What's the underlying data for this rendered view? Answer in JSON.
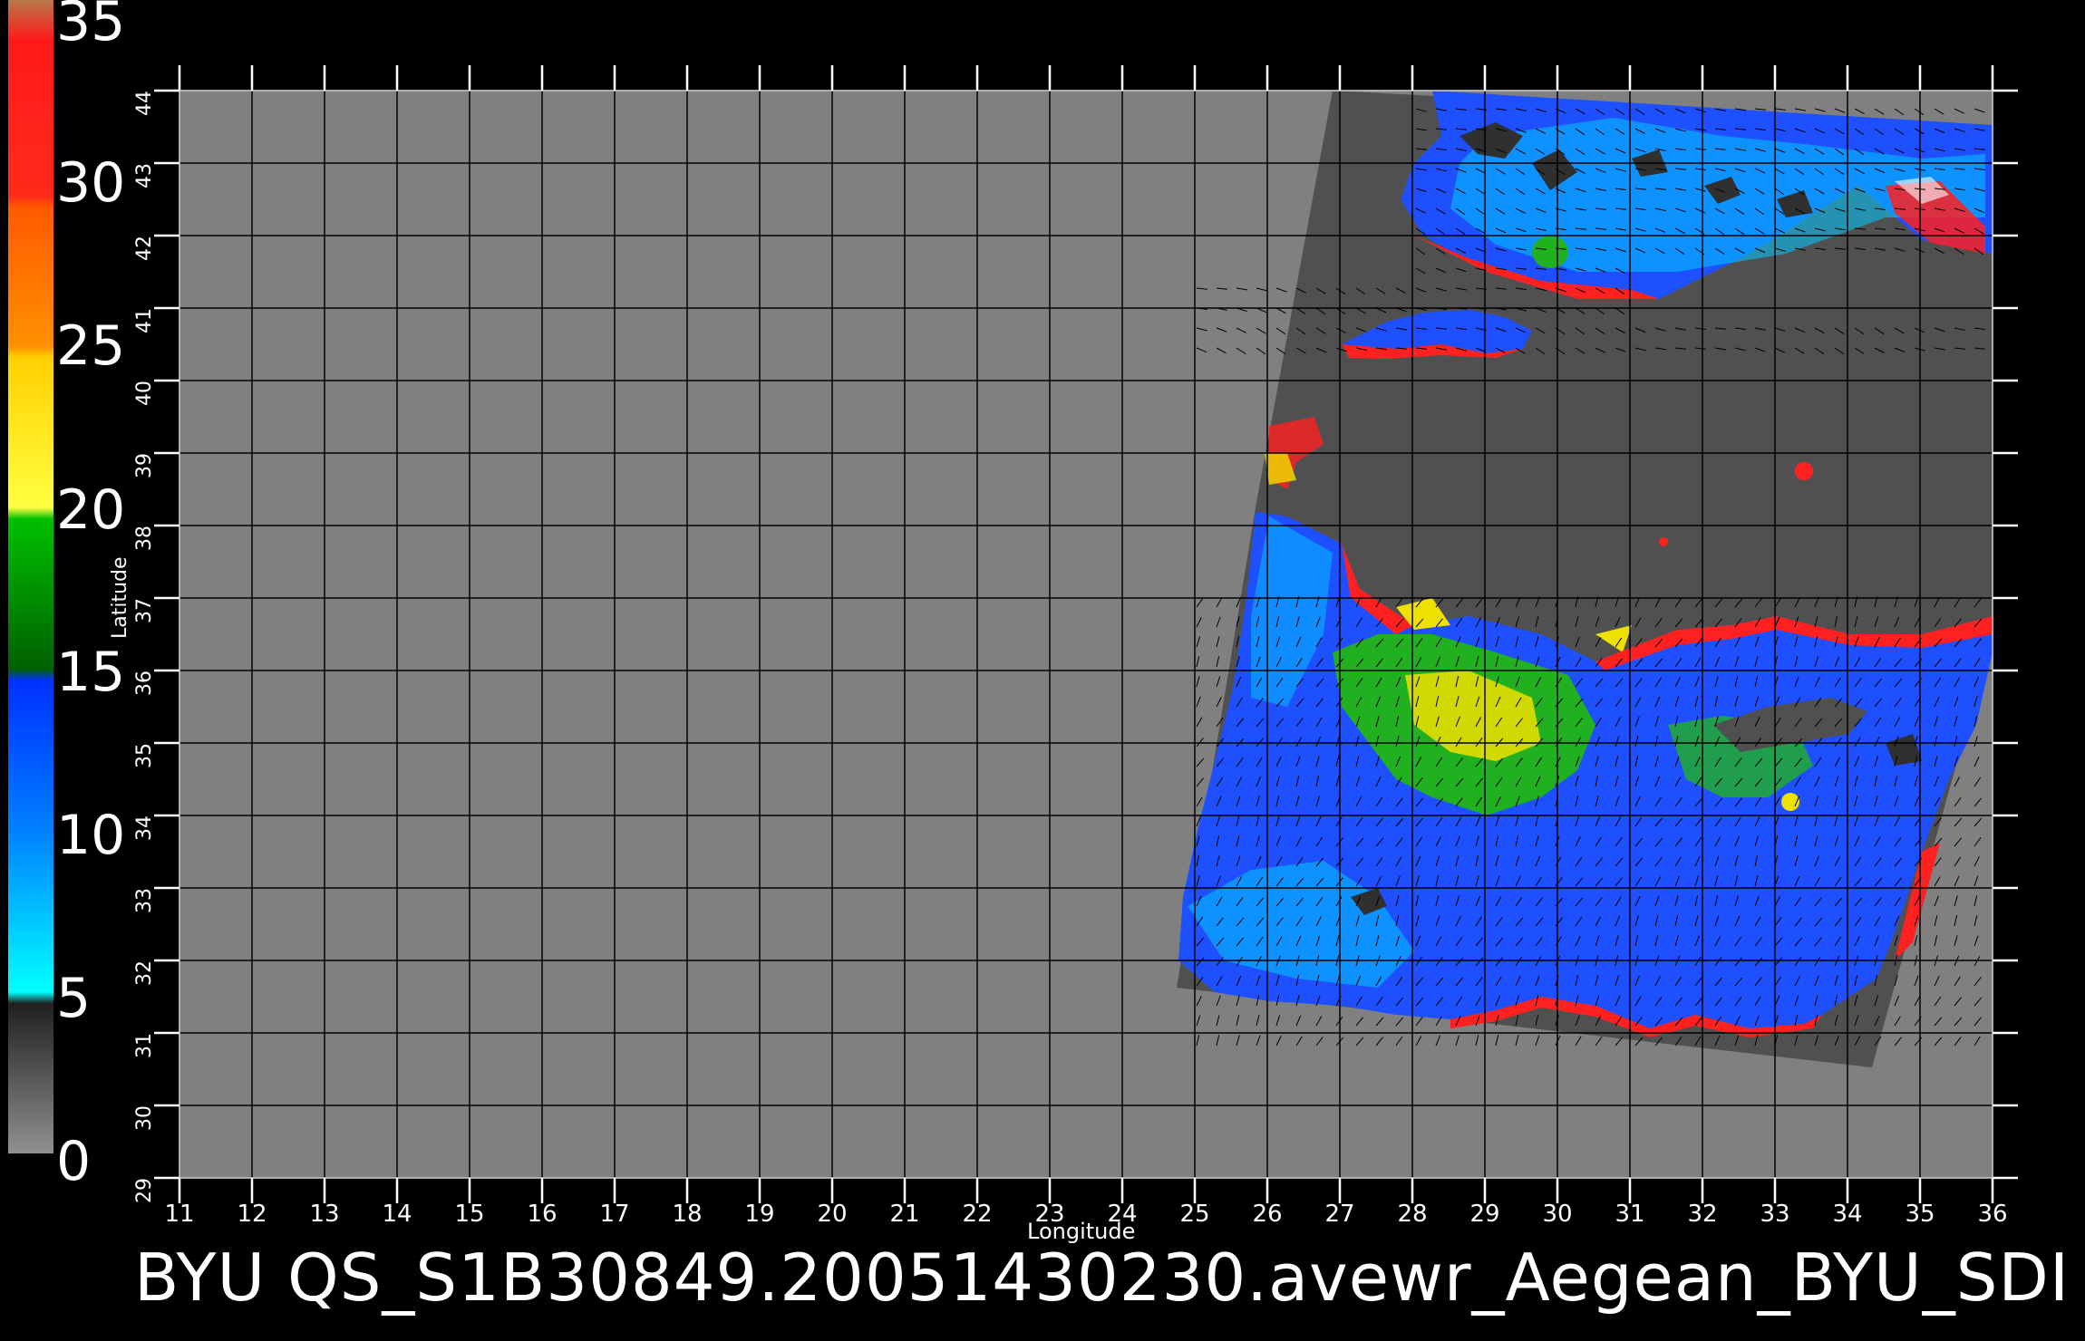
{
  "caption": "BYU  QS_S1B30849.20051430230.avewr_Aegean_BYU_SDI",
  "axes": {
    "x_title": "Longitude",
    "y_title": "Latitude",
    "x_ticks": [
      "11",
      "12",
      "13",
      "14",
      "15",
      "16",
      "17",
      "18",
      "19",
      "20",
      "21",
      "22",
      "23",
      "24",
      "25",
      "26",
      "27",
      "28",
      "29",
      "30",
      "31",
      "32",
      "33",
      "34",
      "35",
      "36"
    ],
    "y_ticks": [
      "29",
      "30",
      "31",
      "32",
      "33",
      "34",
      "35",
      "36",
      "37",
      "38",
      "39",
      "40",
      "41",
      "42",
      "43",
      "44"
    ]
  },
  "colorbar": {
    "labels": [
      "35",
      "30",
      "25",
      "20",
      "15",
      "10",
      "5",
      "0"
    ],
    "colors": [
      "#b8784a",
      "#ff1a1a",
      "#ff5a00",
      "#ffd000",
      "#00b000",
      "#1e50ff",
      "#00f0ff",
      "#505050"
    ]
  },
  "map_colors": {
    "background": "#808080",
    "swath": "#505050",
    "low": "#1e50ff",
    "mid": "#00c8ff",
    "green": "#20b020",
    "yellow": "#f0e000",
    "red": "#ff2020"
  },
  "chart_data": {
    "type": "heatmap",
    "xlim": [
      11,
      36
    ],
    "ylim": [
      29,
      44
    ],
    "xlabel": "Longitude",
    "ylabel": "Latitude",
    "colorbar_range": [
      0,
      35
    ],
    "grid": true
  }
}
